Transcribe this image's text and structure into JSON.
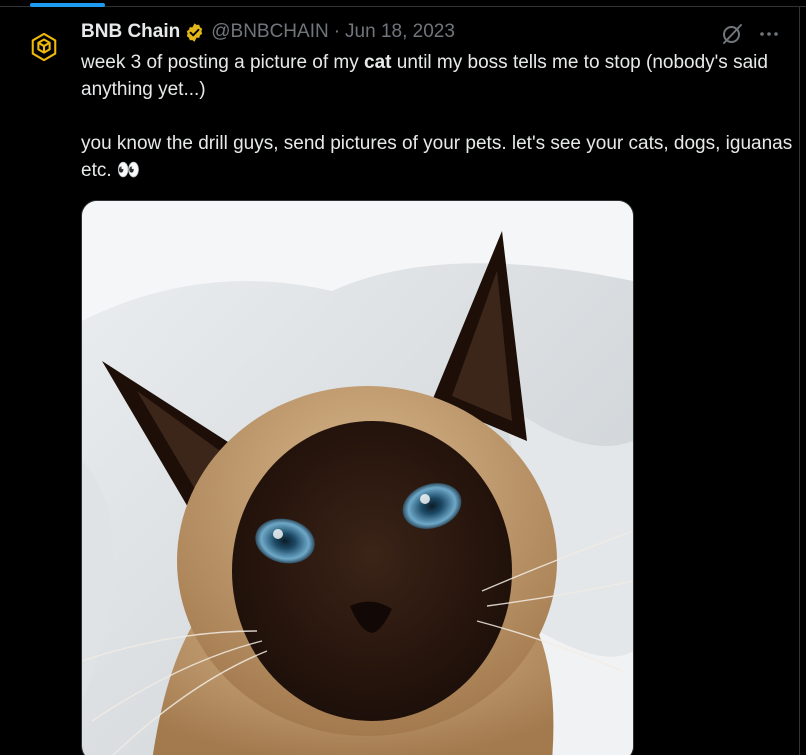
{
  "tweet": {
    "author_name": "BNB Chain",
    "author_handle": "@BNBCHAIN",
    "separator": "·",
    "date": "Jun 18, 2023",
    "text_line1_pre": "week 3 of posting a picture of my ",
    "text_line1_bold": "cat",
    "text_line1_post": " until my boss tells me to stop (nobody's said anything yet...)",
    "text_line2": "you know the drill guys, send pictures of your pets. let's see your cats, dogs, iguanas etc. 👀",
    "verified_badge_icon": "verified-badge-icon",
    "avatar_icon": "bnb-logo-icon",
    "media_icon": "cat-photo"
  },
  "colors": {
    "background": "#000000",
    "text": "#e7e9ea",
    "muted": "#71767b",
    "accent": "#1d9bf0",
    "bnb_yellow": "#f0b90b"
  }
}
